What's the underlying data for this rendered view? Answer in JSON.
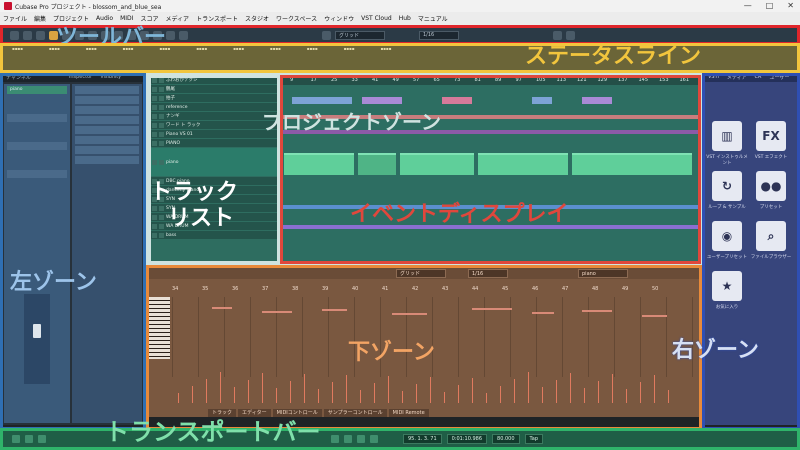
{
  "window": {
    "title": "Cubase Pro プロジェクト - blossom_and_blue_sea",
    "controls": [
      "—",
      "□",
      "✕"
    ]
  },
  "menu": [
    "ファイル",
    "編集",
    "プロジェクト",
    "Audio",
    "MIDI",
    "スコア",
    "メディア",
    "トランスポート",
    "スタジオ",
    "ワークスペース",
    "ウィンドウ",
    "VST Cloud",
    "Hub",
    "マニュアル"
  ],
  "toolbar": {
    "grid_label": "グリッド",
    "quantize_label": "1/16"
  },
  "tracks": [
    "ふわおがテクシ",
    "鶴尾",
    "拍子",
    "reference",
    "ナンギ",
    "ワード ト ラック",
    "Piano VS 01",
    "PIANO",
    "piano",
    "DBC piano",
    "danceny piano",
    "SYN",
    "SYN",
    "WA DRUM",
    "WA DRUM",
    "bass"
  ],
  "ruler_marks": [
    "9",
    "17",
    "25",
    "33",
    "41",
    "49",
    "57",
    "65",
    "73",
    "81",
    "89",
    "97",
    "105",
    "113",
    "121",
    "129",
    "137",
    "145",
    "153",
    "161"
  ],
  "lower_ruler": [
    "34",
    "35",
    "36",
    "37",
    "38",
    "39",
    "40",
    "41",
    "42",
    "43",
    "44",
    "45",
    "46",
    "47",
    "48",
    "49",
    "50"
  ],
  "lower": {
    "track": "piano",
    "grid": "グリッド",
    "quant": "1/16",
    "tabs": [
      "トラック",
      "エディター",
      "MIDIコントロール",
      "サンプラーコントロール",
      "MIDI Remote"
    ]
  },
  "left_tabs": [
    "チャンネル",
    "Inspector",
    "Visibility"
  ],
  "right_tabs": [
    "VSTi",
    "メディア",
    "CR",
    "ユーザー"
  ],
  "right_tiles": [
    {
      "glyph": "▥",
      "caption": "VST インストゥルメント"
    },
    {
      "glyph": "FX",
      "caption": "VST エフェクト"
    },
    {
      "glyph": "↻",
      "caption": "ループ & サンプル"
    },
    {
      "glyph": "●●",
      "caption": "プリセット"
    },
    {
      "glyph": "◉",
      "caption": "ユーザープリセット"
    },
    {
      "glyph": "⌕",
      "caption": "ファイルブラウザー"
    },
    {
      "glyph": "★",
      "caption": "お気に入り"
    }
  ],
  "transport": {
    "position": "95. 1. 3. 71",
    "time": "0:01:10.986",
    "tempo": "80.000",
    "tap": "Tap"
  },
  "zones": {
    "toolbar": "ツールバー",
    "statusline": "ステータスライン",
    "project": "プロジェクトゾーン",
    "tracklist": "トラック\nリスト",
    "eventdisplay": "イベントディスプレイ",
    "left": "左ゾーン",
    "lower": "下ゾーン",
    "right": "右ゾーン",
    "transport": "トランスポートバー"
  },
  "colors": {
    "toolbar": "#e0262b",
    "statusline": "#f2c53d",
    "project": "#cfe3e0",
    "tracklist": "#cfe3e0",
    "eventdisplay": "#e0473c",
    "left": "#2f6fb3",
    "lower": "#e88a3a",
    "right": "#2f4fb3",
    "transport": "#2fb36a"
  }
}
